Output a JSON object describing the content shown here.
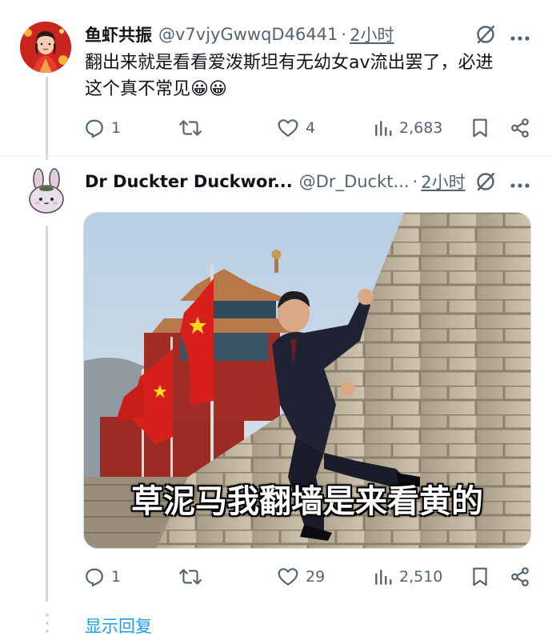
{
  "tweet1": {
    "name": "鱼虾共振",
    "handle": "@v7vjyGwwqD46441",
    "separator": "·",
    "time": "2小时",
    "text_line1": "翻出来就是看看爱泼斯坦有无幼女av流出罢了，必进",
    "text_line2": "这个真不常见",
    "emoji": "😀😀",
    "replies": "1",
    "retweets": "",
    "likes": "4",
    "views": "2,683"
  },
  "tweet2": {
    "name": "Dr Duckter Duckwor...",
    "handle": "@Dr_Duckt...",
    "separator": "·",
    "time": "2小时",
    "image_caption": "草泥马我翻墙是来看黄的",
    "replies": "1",
    "retweets": "",
    "likes": "29",
    "views": "2,510"
  },
  "show_replies": "显示回复",
  "colors": {
    "text": "#0f1419",
    "secondary": "#536471",
    "link": "#1d9bf0",
    "thread_line": "#cfd9de",
    "flag_red": "#d7201c",
    "flag_star": "#f8d71c"
  },
  "icons": [
    "grok-icon",
    "more-icon",
    "reply-icon",
    "retweet-icon",
    "like-icon",
    "views-icon",
    "bookmark-icon",
    "share-icon"
  ]
}
